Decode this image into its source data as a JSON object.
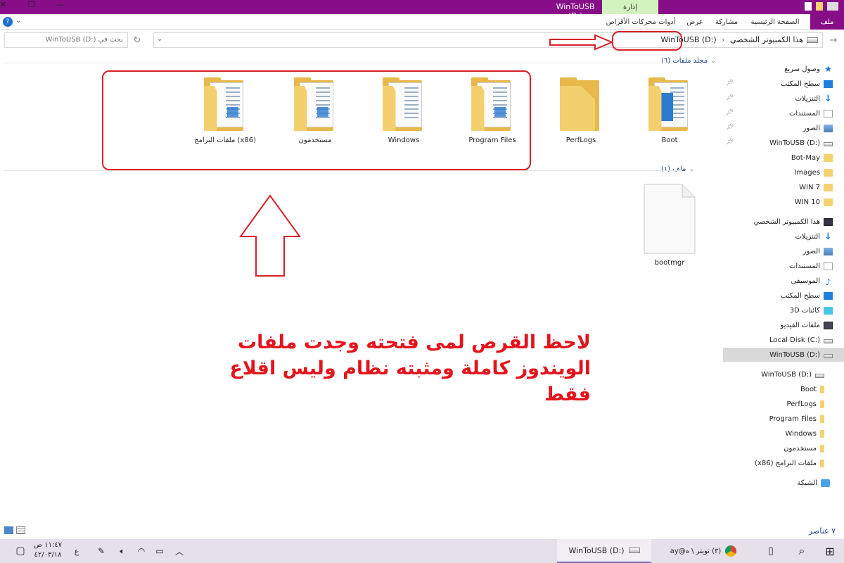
{
  "window": {
    "title": "WinToUSB (D:)",
    "manage_label": "إدارة",
    "close_glyph": "✕",
    "restore_glyph": "❐"
  },
  "ribbon": {
    "file": "ملف",
    "tabs": [
      "الصفحة الرئيسية",
      "مشاركة",
      "عرض",
      "أدوات محركات الأقراص"
    ],
    "help_glyph": "?"
  },
  "address": {
    "crumbs": [
      "هذا الكمبيوتر الشخصي",
      "WinToUSB (D:)"
    ],
    "search_placeholder": "بحث في WinToUSB (D:)"
  },
  "sidebar": {
    "quick_access": "وصول سريع",
    "quick_items": [
      {
        "label": "سطح المكتب",
        "icon": "desktop-icon",
        "pinned": true
      },
      {
        "label": "التنزيلات",
        "icon": "downloads-icon",
        "pinned": true
      },
      {
        "label": "المستندات",
        "icon": "documents-icon",
        "pinned": true
      },
      {
        "label": "الصور",
        "icon": "pictures-icon",
        "pinned": true
      },
      {
        "label": "WinToUSB (D:)",
        "icon": "drive-icon",
        "pinned": true
      },
      {
        "label": "Bot-May",
        "icon": "folder-icon",
        "pinned": false
      },
      {
        "label": "Images",
        "icon": "folder-icon",
        "pinned": false
      },
      {
        "label": "WIN 7",
        "icon": "folder-icon",
        "pinned": false
      },
      {
        "label": "WIN 10",
        "icon": "folder-icon",
        "pinned": false
      }
    ],
    "this_pc": "هذا الكمبيوتر الشخصي",
    "pc_items": [
      {
        "label": "التنزيلات",
        "icon": "downloads-icon"
      },
      {
        "label": "الصور",
        "icon": "pictures-icon"
      },
      {
        "label": "المستندات",
        "icon": "documents-icon"
      },
      {
        "label": "الموسيقى",
        "icon": "music-icon"
      },
      {
        "label": "سطح المكتب",
        "icon": "desktop-icon"
      },
      {
        "label": "كائنات 3D",
        "icon": "objects-3d-icon"
      },
      {
        "label": "ملفات الفيديو",
        "icon": "videos-icon"
      },
      {
        "label": "Local Disk (C:)",
        "icon": "drive-icon"
      },
      {
        "label": "WinToUSB (D:)",
        "icon": "drive-icon",
        "selected": true
      }
    ],
    "drive_tree_title": "WinToUSB (D:)",
    "drive_items": [
      "Boot",
      "PerfLogs",
      "Program Files",
      "Windows",
      "مستخدمون",
      "ملفات البرامج (x86)"
    ],
    "network": "الشبكة"
  },
  "content": {
    "folders_group": "مجلد ملفات (٦)",
    "folders": [
      "Boot",
      "PerfLogs",
      "Program Files",
      "Windows",
      "مستخدمون",
      "ملفات البرامج (x86)"
    ],
    "files_group": "ملف (١)",
    "files": [
      "bootmgr"
    ],
    "annotation_line1": "لاحظ القرص لمى فتحته وجدت ملفات",
    "annotation_line2": "الويندوز كاملة ومثبته نظام وليس اقلاع فقط"
  },
  "status": {
    "item_count": "٧ عناصر"
  },
  "taskbar": {
    "explorer_label": "WinToUSB (D:)",
    "chrome_label": "(٣) تويتر \\ ه@ay",
    "time": "١١:٤٧ ص",
    "date": "٤٢/٠٣/١٨",
    "lang": "ع"
  },
  "colors": {
    "titlebar": "#880e88",
    "manage_tab": "#d2f3c0",
    "annotation": "#e3141c",
    "folder": "#f3cf6e"
  }
}
